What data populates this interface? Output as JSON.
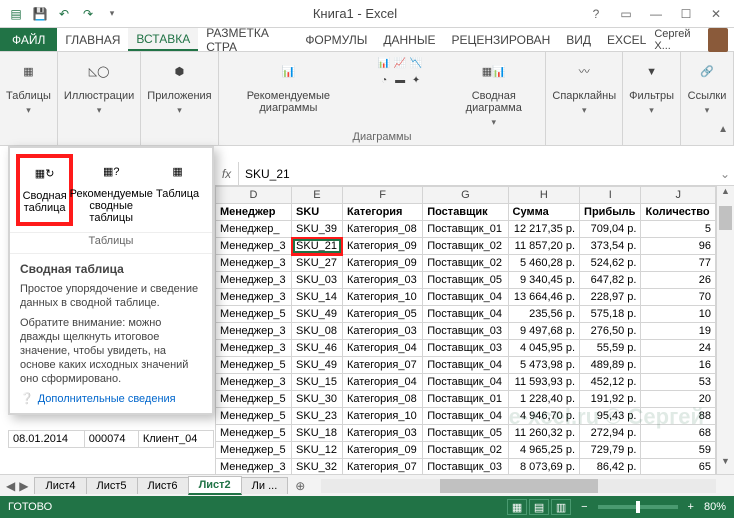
{
  "window": {
    "title": "Книга1 - Excel"
  },
  "qat_icons": [
    "excel",
    "save",
    "undo",
    "redo"
  ],
  "tabs": {
    "file": "ФАЙЛ",
    "items": [
      "ГЛАВНАЯ",
      "ВСТАВКА",
      "РАЗМЕТКА СТРА",
      "ФОРМУЛЫ",
      "ДАННЫЕ",
      "РЕЦЕНЗИРОВАН",
      "ВИД",
      "EXCEL"
    ],
    "active_index": 1,
    "user": "Сергей Х..."
  },
  "ribbon": {
    "groups": [
      {
        "label": "Таблицы",
        "buttons": [
          {
            "name": "tables",
            "label": "Таблицы"
          }
        ]
      },
      {
        "label": "",
        "buttons": [
          {
            "name": "illustrations",
            "label": "Иллюстрации"
          }
        ]
      },
      {
        "label": "",
        "buttons": [
          {
            "name": "apps",
            "label": "Приложения"
          }
        ]
      },
      {
        "label": "Диаграммы",
        "buttons": [
          {
            "name": "recommended-charts",
            "label": "Рекомендуемые диаграммы"
          },
          {
            "name": "chart-gallery",
            "label": ""
          },
          {
            "name": "pivot-chart",
            "label": "Сводная диаграмма"
          }
        ]
      },
      {
        "label": "",
        "buttons": [
          {
            "name": "sparklines",
            "label": "Спарклайны"
          }
        ]
      },
      {
        "label": "",
        "buttons": [
          {
            "name": "filters",
            "label": "Фильтры"
          }
        ]
      },
      {
        "label": "",
        "buttons": [
          {
            "name": "links",
            "label": "Ссылки"
          }
        ]
      }
    ]
  },
  "pivot_panel": {
    "group_label": "Таблицы",
    "buttons": [
      {
        "name": "pivot-table",
        "label": "Сводная таблица",
        "highlighted": true
      },
      {
        "name": "recommended-pivot",
        "label": "Рекомендуемые сводные таблицы"
      },
      {
        "name": "table",
        "label": "Таблица"
      }
    ],
    "tooltip": {
      "title": "Сводная таблица",
      "p1": "Простое упорядочение и сведение данных в сводной таблице.",
      "p2": "Обратите внимание: можно дважды щелкнуть итоговое значение, чтобы увидеть, на основе каких исходных значений оно сформировано.",
      "help": "Дополнительные сведения"
    }
  },
  "formula_bar": {
    "value": "SKU_21"
  },
  "grid": {
    "col_letters": [
      "D",
      "E",
      "F",
      "G",
      "H",
      "I",
      "J"
    ],
    "headers": [
      "Менеджер",
      "SKU",
      "Категория",
      "Поставщик",
      "Сумма",
      "Прибыль",
      "Количество"
    ],
    "selected": {
      "row": 1,
      "col": 1
    },
    "rows": [
      [
        "Менеджер_",
        "SKU_39",
        "Категория_08",
        "Поставщик_01",
        "12 217,35 p.",
        "709,04 p.",
        "5"
      ],
      [
        "Менеджер_3",
        "SKU_21",
        "Категория_09",
        "Поставщик_02",
        "11 857,20 p.",
        "373,54 p.",
        "96"
      ],
      [
        "Менеджер_3",
        "SKU_27",
        "Категория_09",
        "Поставщик_02",
        "5 460,28 p.",
        "524,62 p.",
        "77"
      ],
      [
        "Менеджер_3",
        "SKU_03",
        "Категория_03",
        "Поставщик_05",
        "9 340,45 p.",
        "647,82 p.",
        "26"
      ],
      [
        "Менеджер_3",
        "SKU_14",
        "Категория_10",
        "Поставщик_04",
        "13 664,46 p.",
        "228,97 p.",
        "70"
      ],
      [
        "Менеджер_5",
        "SKU_49",
        "Категория_05",
        "Поставщик_04",
        "235,56 p.",
        "575,18 p.",
        "10"
      ],
      [
        "Менеджер_3",
        "SKU_08",
        "Категория_03",
        "Поставщик_03",
        "9 497,68 p.",
        "276,50 p.",
        "19"
      ],
      [
        "Менеджер_3",
        "SKU_46",
        "Категория_04",
        "Поставщик_03",
        "4 045,95 p.",
        "55,59 p.",
        "24"
      ],
      [
        "Менеджер_5",
        "SKU_49",
        "Категория_07",
        "Поставщик_04",
        "5 473,98 p.",
        "489,89 p.",
        "16"
      ],
      [
        "Менеджер_3",
        "SKU_15",
        "Категория_04",
        "Поставщик_04",
        "11 593,93 p.",
        "452,12 p.",
        "53"
      ],
      [
        "Менеджер_5",
        "SKU_30",
        "Категория_08",
        "Поставщик_01",
        "1 228,40 p.",
        "191,92 p.",
        "20"
      ],
      [
        "Менеджер_5",
        "SKU_23",
        "Категория_10",
        "Поставщик_04",
        "4 946,70 p.",
        "95,43 p.",
        "88"
      ],
      [
        "Менеджер_5",
        "SKU_18",
        "Категория_03",
        "Поставщик_05",
        "11 260,32 p.",
        "272,94 p.",
        "68"
      ],
      [
        "Менеджер_5",
        "SKU_12",
        "Категория_09",
        "Поставщик_02",
        "4 965,25 p.",
        "729,79 p.",
        "59"
      ],
      [
        "Менеджер_3",
        "SKU_32",
        "Категория_07",
        "Поставщик_03",
        "8 073,69 p.",
        "86,42 p.",
        "65"
      ]
    ]
  },
  "left_stub": [
    [
      "08.01.2014",
      "000074",
      "Клиент_04"
    ]
  ],
  "sheets": {
    "items": [
      "Лист4",
      "Лист5",
      "Лист6",
      "Лист2",
      "Ли ..."
    ],
    "active_index": 3
  },
  "status": {
    "label": "ГОТОВО",
    "zoom": "80%"
  },
  "watermark": "e-xcel.ru © Сергей"
}
